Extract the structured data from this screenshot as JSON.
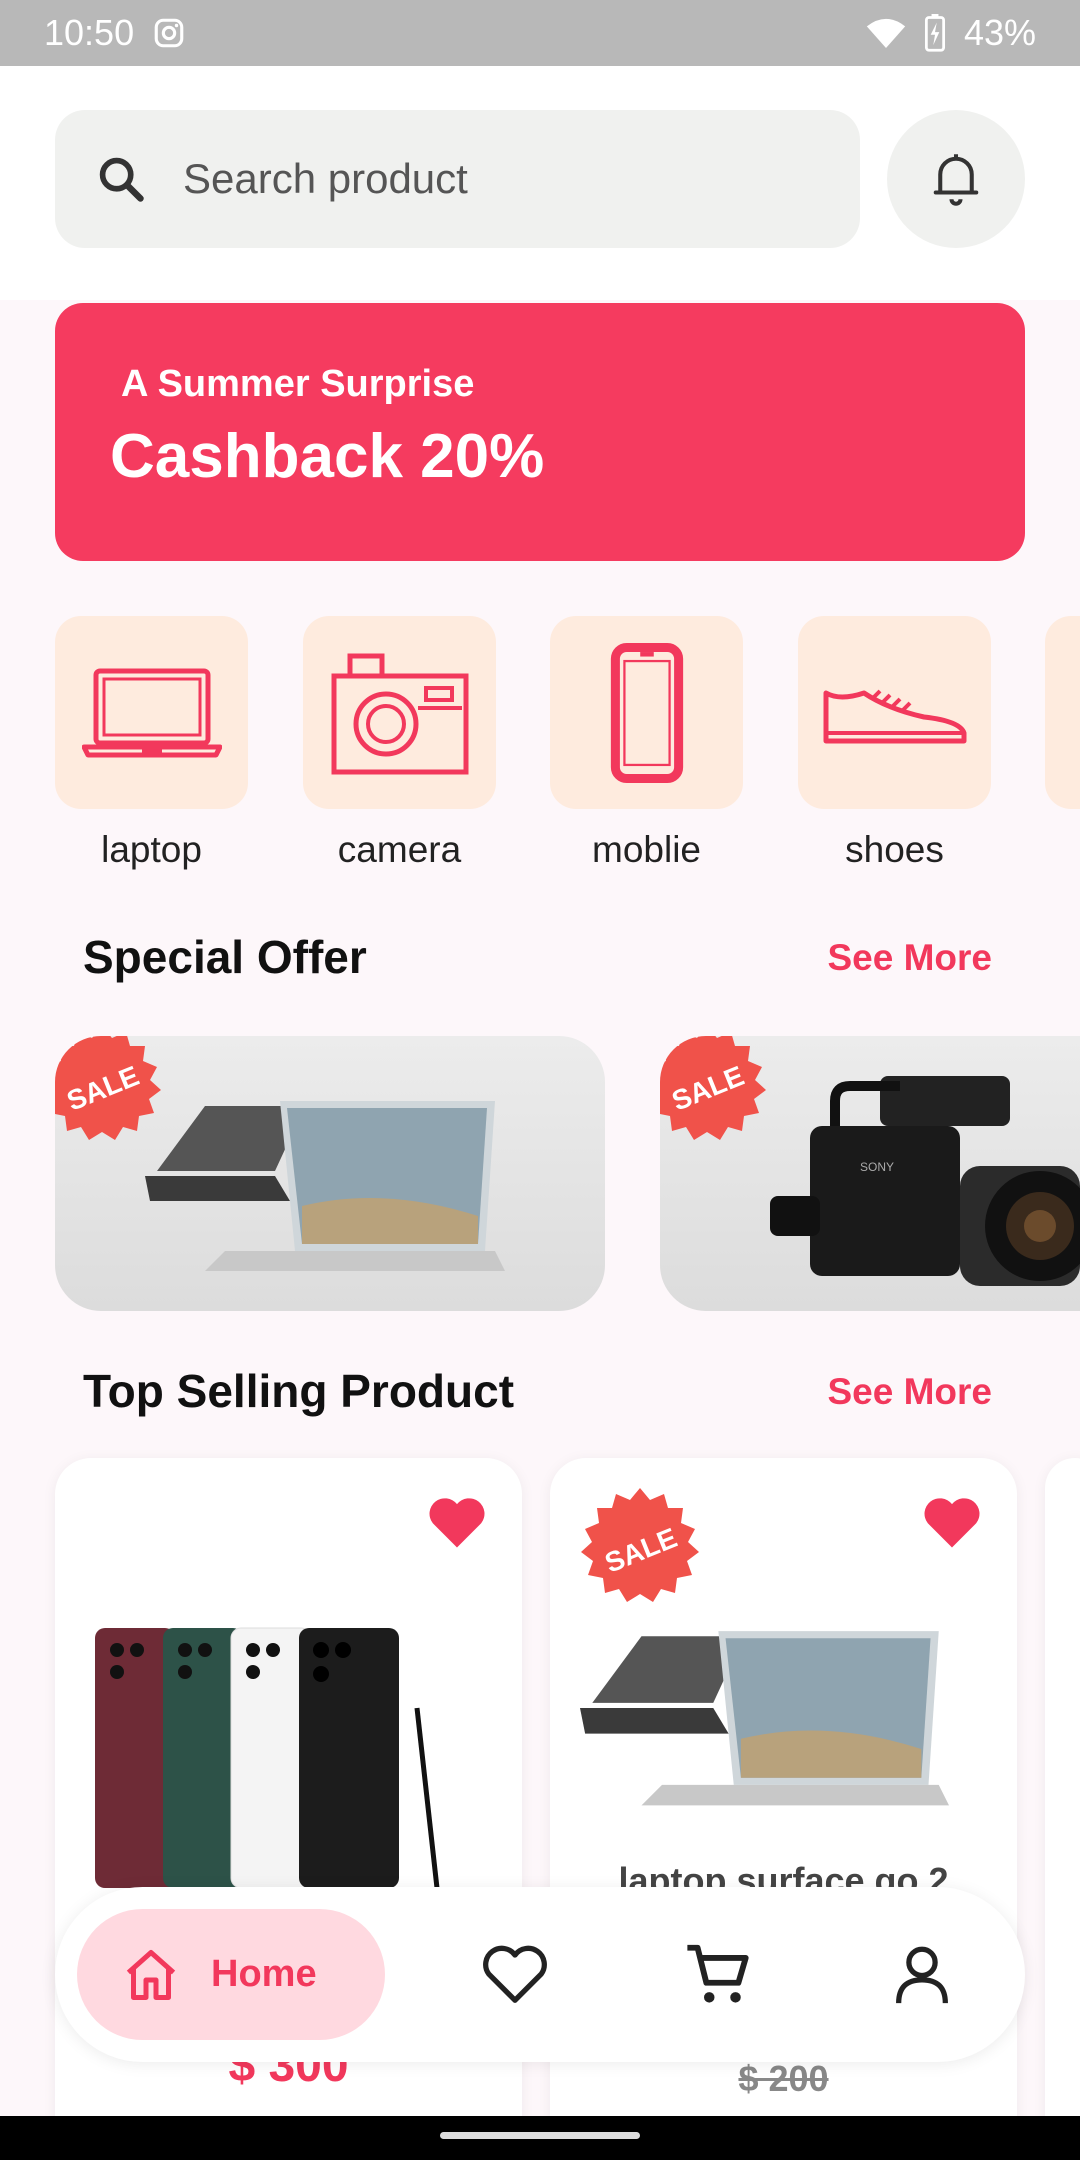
{
  "status_bar": {
    "time": "10:50",
    "battery": "43%"
  },
  "search": {
    "placeholder": "Search product"
  },
  "banner": {
    "subtitle": "A Summer Surprise",
    "title": "Cashback 20%"
  },
  "categories": [
    {
      "label": "laptop",
      "icon": "laptop-icon"
    },
    {
      "label": "camera",
      "icon": "camera-icon"
    },
    {
      "label": "moblie",
      "icon": "mobile-icon"
    },
    {
      "label": "shoes",
      "icon": "shoe-icon"
    }
  ],
  "special_offer": {
    "title": "Special Offer",
    "see_more": "See More",
    "badge": "SALE"
  },
  "top_selling": {
    "title": "Top Selling Product",
    "see_more": "See More",
    "products": [
      {
        "name": "",
        "price": "$ 300"
      },
      {
        "name": "laptop surface go 2",
        "old_price": "$ 200",
        "badge": "SALE"
      }
    ]
  },
  "nav": {
    "home": "Home"
  },
  "colors": {
    "accent": "#f53b5f",
    "category_bg": "#feebde",
    "nav_active_bg": "#ffd9e0"
  }
}
